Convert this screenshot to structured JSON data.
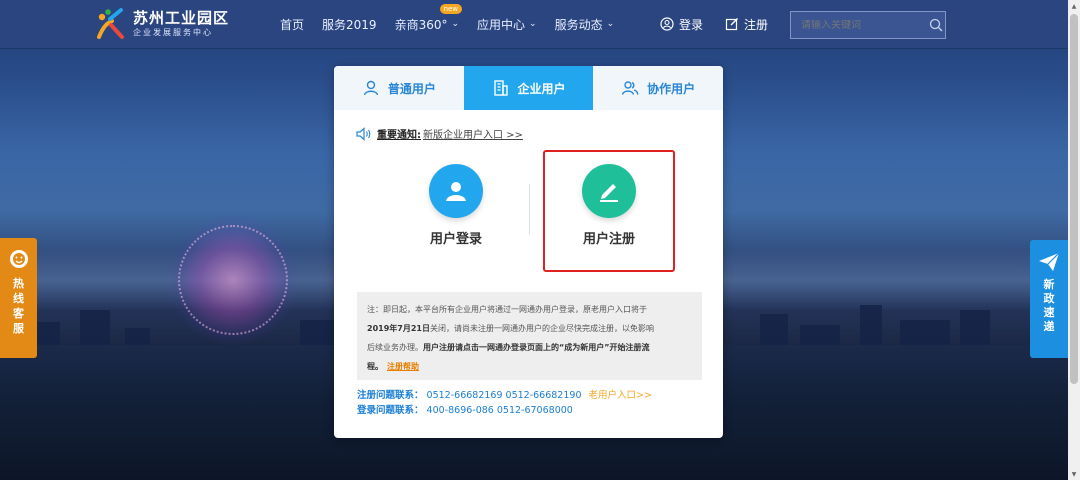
{
  "header": {
    "logo": {
      "title": "苏州工业园区",
      "subtitle": "企业发展服务中心"
    },
    "nav": [
      {
        "label": "首页",
        "has_dropdown": false
      },
      {
        "label": "服务2019",
        "has_dropdown": false
      },
      {
        "label": "亲商360°",
        "has_dropdown": true,
        "badge": "new"
      },
      {
        "label": "应用中心",
        "has_dropdown": true
      },
      {
        "label": "服务动态",
        "has_dropdown": true
      }
    ],
    "login_label": "登录",
    "register_label": "注册",
    "search": {
      "placeholder": "请输入关键词",
      "icon": "search-icon"
    }
  },
  "panel": {
    "tabs": [
      {
        "label": "普通用户",
        "icon": "user-icon",
        "active": false
      },
      {
        "label": "企业用户",
        "icon": "building-icon",
        "active": true
      },
      {
        "label": "协作用户",
        "icon": "users-icon",
        "active": false
      }
    ],
    "notice": {
      "strong": "重要通知:",
      "text": "新版企业用户入口 >>",
      "icon": "speaker-icon"
    },
    "actions": [
      {
        "label": "用户登录",
        "icon": "user-avatar-icon",
        "color": "#22a6ee"
      },
      {
        "label": "用户注册",
        "icon": "edit-pencil-icon",
        "color": "#1fbf9a"
      }
    ],
    "note": {
      "line1": "注：即日起，本平台所有企业用户将通过一网通办用户登录，原老用户入口将于",
      "bold_date": "2019年7月21日",
      "line2": "关闭，请尚未注册一网通办用户的企业尽快完成注册，以免影响",
      "line3_a": "后续业务办理。",
      "line3_b": "用户注册请点击一网通办登录页面上的“成为新用户”开始注册流",
      "line4_b": "程。",
      "help_link": "注册帮助"
    },
    "contacts": [
      {
        "label": "注册问题联系：",
        "numbers": "0512-66682169 0512-66682190",
        "extra": "老用户入口>>"
      },
      {
        "label": "登录问题联系：",
        "numbers": "400-8696-086 0512-67068000",
        "extra": ""
      }
    ]
  },
  "side": {
    "hotline": {
      "label": "热线客服",
      "chars": [
        "热",
        "线",
        "客",
        "服"
      ]
    },
    "express": {
      "label": "新政速递",
      "chars": [
        "新",
        "政",
        "速",
        "递"
      ]
    }
  },
  "colors": {
    "nav_bg": "#2b4580",
    "tab_active": "#22a6ee",
    "login_circle": "#22a6ee",
    "register_circle": "#1fbf9a",
    "highlight": "#e0221e",
    "hotline_bg": "#e38a16",
    "express_bg": "#1d8fe0"
  }
}
